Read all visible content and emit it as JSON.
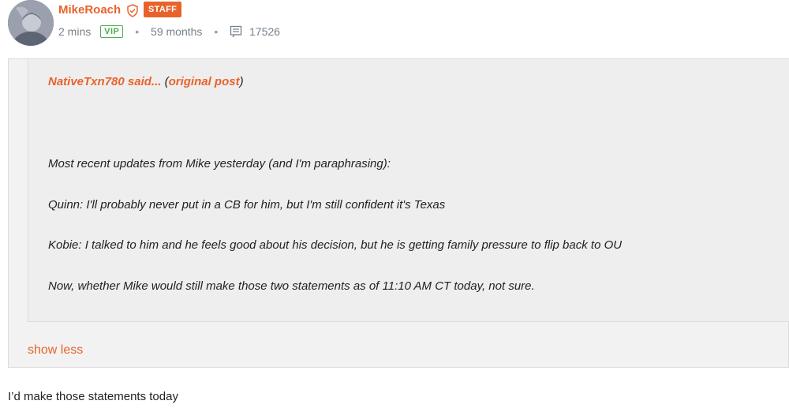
{
  "post": {
    "username": "MikeRoach",
    "staff_badge": "STAFF",
    "time_ago": "2 mins",
    "vip_badge": "VIP",
    "member_for": "59 months",
    "message_count": "17526",
    "icons": {
      "verified": "shield-check-icon",
      "messages": "message-lines-icon"
    }
  },
  "quote": {
    "author": "NativeTxn780",
    "said": " said...",
    "open_paren": " (",
    "link_label": "original post",
    "close_paren": ")",
    "lines": [
      "Most recent updates from Mike yesterday (and I'm paraphrasing):",
      "Quinn: I'll probably never put in a CB for him, but I'm still confident it's Texas",
      "Kobie: I talked to him and he feels good about his decision, but he is getting family pressure to flip back to OU",
      "Now, whether Mike would still make those two statements as of 11:10 AM CT today, not sure."
    ],
    "toggle_label": "show less"
  },
  "reply": {
    "text": "I’d make those statements today"
  },
  "colors": {
    "accent": "#e8632b",
    "vip": "#4caf50",
    "quote_bg": "#eeeeee",
    "meta_text": "#77808c"
  }
}
